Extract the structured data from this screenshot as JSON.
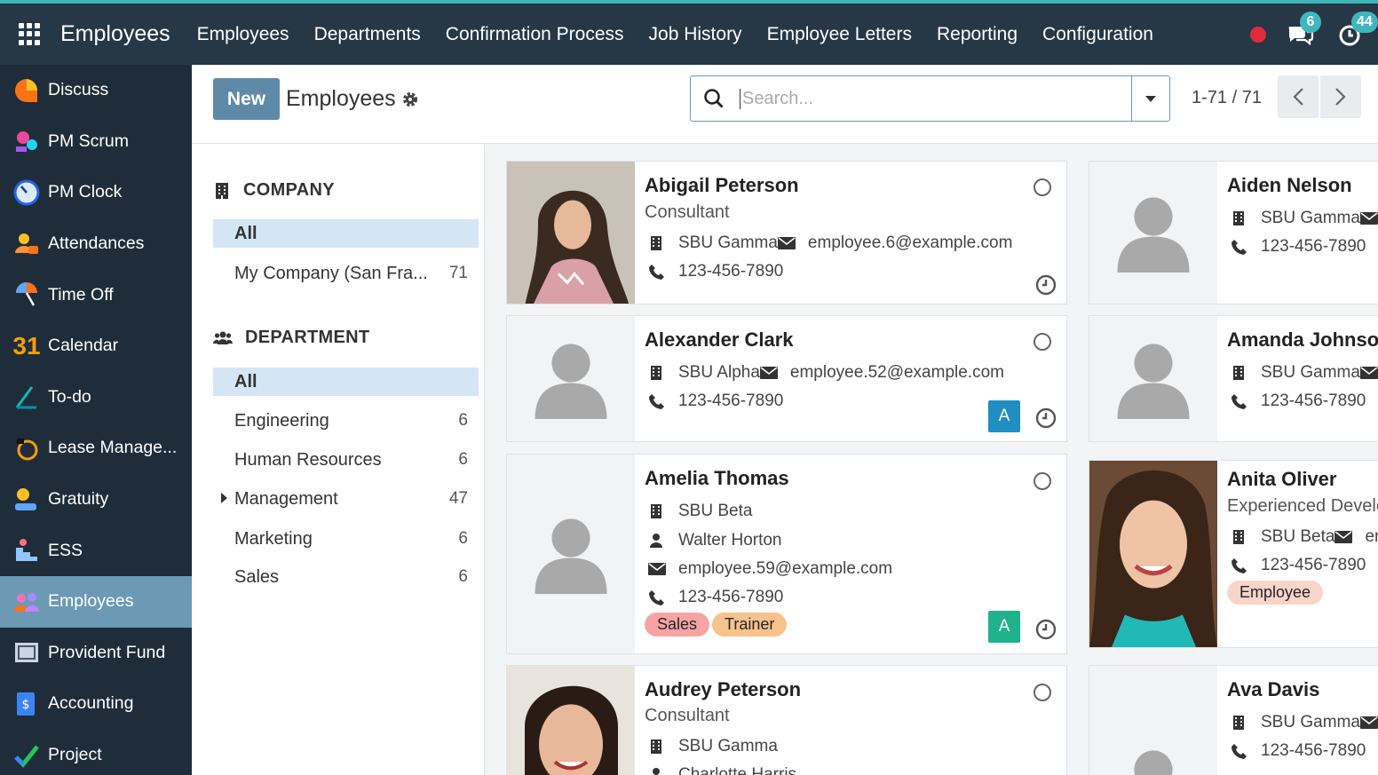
{
  "topbar": {
    "app_title": "Employees",
    "menu": [
      "Employees",
      "Departments",
      "Confirmation Process",
      "Job History",
      "Employee Letters",
      "Reporting",
      "Configuration"
    ],
    "messages_count": "6",
    "activities_count": "44"
  },
  "sidebar": {
    "items": [
      {
        "label": "Discuss",
        "icon": "discuss-icon"
      },
      {
        "label": "PM Scrum",
        "icon": "pm-scrum-icon"
      },
      {
        "label": "PM Clock",
        "icon": "pm-clock-icon"
      },
      {
        "label": "Attendances",
        "icon": "attendances-icon"
      },
      {
        "label": "Time Off",
        "icon": "time-off-icon"
      },
      {
        "label": "Calendar",
        "icon": "calendar-icon"
      },
      {
        "label": "To-do",
        "icon": "todo-icon"
      },
      {
        "label": "Lease Manage...",
        "icon": "lease-icon"
      },
      {
        "label": "Gratuity",
        "icon": "gratuity-icon"
      },
      {
        "label": "ESS",
        "icon": "ess-icon"
      },
      {
        "label": "Employees",
        "icon": "employees-icon",
        "active": true
      },
      {
        "label": "Provident Fund",
        "icon": "provident-fund-icon"
      },
      {
        "label": "Accounting",
        "icon": "accounting-icon"
      },
      {
        "label": "Project",
        "icon": "project-icon"
      }
    ],
    "calendar_glyph": "31"
  },
  "control": {
    "new_label": "New",
    "title": "Employees",
    "search_placeholder": "Search...",
    "pager": "1-71 / 71"
  },
  "searchpanel": {
    "company_header": "COMPANY",
    "company_items": [
      {
        "label": "All",
        "count": "",
        "selected": true
      },
      {
        "label": "My Company (San Fra...",
        "count": "71"
      }
    ],
    "department_header": "DEPARTMENT",
    "department_items": [
      {
        "label": "All",
        "count": "",
        "selected": true
      },
      {
        "label": "Engineering",
        "count": "6"
      },
      {
        "label": "Human Resources",
        "count": "6"
      },
      {
        "label": "Management",
        "count": "47",
        "expandable": true
      },
      {
        "label": "Marketing",
        "count": "6"
      },
      {
        "label": "Sales",
        "count": "6"
      }
    ]
  },
  "employees": [
    {
      "name": "Abigail Peterson",
      "job": "Consultant",
      "company": "SBU Gamma",
      "email": "employee.6@example.com",
      "phone": "123-456-7890"
    },
    {
      "name": "Aiden Nelson",
      "company": "SBU Gamma",
      "phone": "123-456-7890"
    },
    {
      "name": "Alexander Clark",
      "company": "SBU Alpha",
      "email": "employee.52@example.com",
      "phone": "123-456-7890",
      "badge": "A"
    },
    {
      "name": "Amanda Johnson",
      "company": "SBU Gamma",
      "phone": "123-456-7890"
    },
    {
      "name": "Amelia Thomas",
      "company": "SBU Beta",
      "manager": "Walter Horton",
      "email": "employee.59@example.com",
      "phone": "123-456-7890",
      "tags": [
        "Sales",
        "Trainer"
      ],
      "badge": "A"
    },
    {
      "name": "Anita Oliver",
      "job": "Experienced Developer",
      "company": "SBU Beta",
      "email": "en",
      "phone": "123-456-7890",
      "tags": [
        "Employee"
      ]
    },
    {
      "name": "Audrey Peterson",
      "job": "Consultant",
      "company": "SBU Gamma",
      "manager": "Charlotte Harris"
    },
    {
      "name": "Ava Davis",
      "company": "SBU Gamma",
      "phone": "123-456-7890"
    }
  ],
  "colors": {
    "topbar": "#263746",
    "sidebar": "#1f2d3a",
    "accent": "#5f8aa7",
    "tag_sales": "#f7a3a3",
    "tag_trainer": "#f8c28c",
    "tag_employee": "#f9d4c8",
    "badge_blue": "#1f8ec2",
    "badge_green": "#20b28b"
  }
}
